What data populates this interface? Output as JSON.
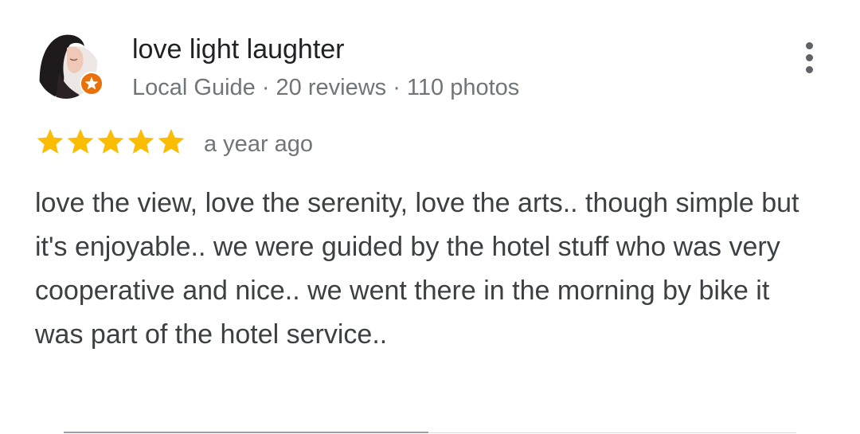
{
  "review": {
    "author_name": "love light laughter",
    "author_meta": "Local Guide · 20 reviews · 110 photos",
    "rating": 5,
    "rating_max": 5,
    "time_ago": "a year ago",
    "text": "love the view, love the serenity, love the arts.. though simple but it's enjoyable.. we were guided by the hotel stuff who was very cooperative and nice.. we went there in the morning by bike it was part of the hotel service..",
    "icons": {
      "avatar": "avatar-photo",
      "badge": "local-guide-star-icon",
      "menu": "more-vert-icon",
      "star": "star-icon"
    },
    "colors": {
      "star": "#FBBC04",
      "badge": "#E8710A",
      "name": "#202124",
      "meta": "#70757a",
      "body": "#3c4043",
      "menu": "#5f6368"
    }
  }
}
